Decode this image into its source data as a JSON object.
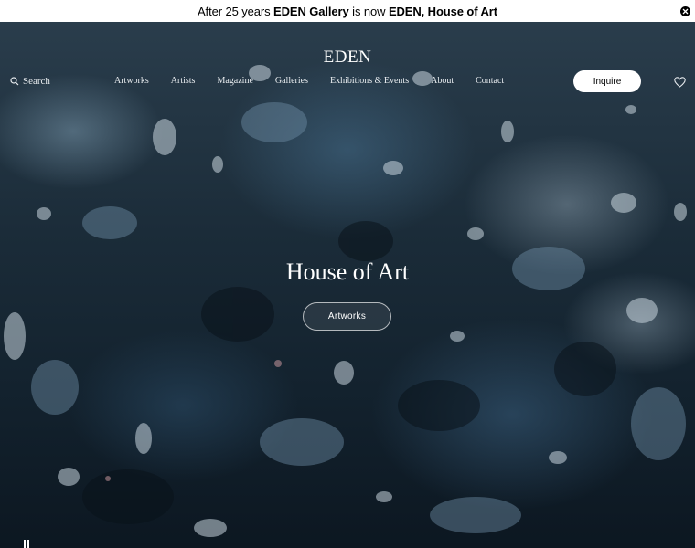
{
  "announcement": {
    "parts": [
      {
        "text": "After 25 years ",
        "bold": false
      },
      {
        "text": "EDEN Gallery",
        "bold": true
      },
      {
        "text": " is now ",
        "bold": false
      },
      {
        "text": "EDEN, House of Art",
        "bold": true
      }
    ],
    "close_icon": "close-icon"
  },
  "header": {
    "logo": "EDEN",
    "search_label": "Search",
    "nav": [
      "Artworks",
      "Artists",
      "Magazine",
      "Galleries",
      "Exhibitions & Events",
      "About",
      "Contact"
    ],
    "inquire_label": "Inquire",
    "wishlist_icon": "heart-icon"
  },
  "hero": {
    "title": "House of Art",
    "cta_label": "Artworks",
    "pause_icon": "pause-icon"
  }
}
